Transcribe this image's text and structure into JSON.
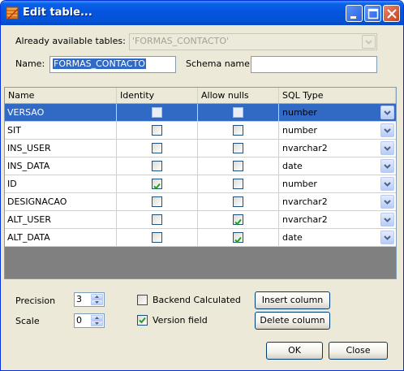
{
  "window": {
    "title": "Edit table..."
  },
  "form": {
    "available_label": "Already available tables:",
    "available_value": "'FORMAS_CONTACTO'",
    "name_label": "Name:",
    "name_value": "FORMAS_CONTACTO",
    "schema_label": "Schema name:",
    "schema_value": ""
  },
  "grid": {
    "headers": [
      "Name",
      "Identity",
      "Allow nulls",
      "SQL Type"
    ],
    "rows": [
      {
        "name": "VERSAO",
        "identity": false,
        "allow_nulls": false,
        "sql_type": "number",
        "selected": true
      },
      {
        "name": "SIT",
        "identity": false,
        "allow_nulls": false,
        "sql_type": "number",
        "selected": false
      },
      {
        "name": "INS_USER",
        "identity": false,
        "allow_nulls": false,
        "sql_type": "nvarchar2",
        "selected": false
      },
      {
        "name": "INS_DATA",
        "identity": false,
        "allow_nulls": false,
        "sql_type": "date",
        "selected": false
      },
      {
        "name": "ID",
        "identity": true,
        "allow_nulls": false,
        "sql_type": "number",
        "selected": false
      },
      {
        "name": "DESIGNACAO",
        "identity": false,
        "allow_nulls": false,
        "sql_type": "nvarchar2",
        "selected": false
      },
      {
        "name": "ALT_USER",
        "identity": false,
        "allow_nulls": true,
        "sql_type": "nvarchar2",
        "selected": false
      },
      {
        "name": "ALT_DATA",
        "identity": false,
        "allow_nulls": true,
        "sql_type": "date",
        "selected": false
      }
    ]
  },
  "props": {
    "precision_label": "Precision",
    "precision_value": "3",
    "scale_label": "Scale",
    "scale_value": "0",
    "backend_calculated_label": "Backend Calculated",
    "backend_calculated_checked": false,
    "version_field_label": "Version field",
    "version_field_checked": true,
    "insert_column_label": "Insert column",
    "delete_column_label": "Delete column"
  },
  "buttons": {
    "ok_label": "OK",
    "close_label": "Close"
  },
  "colors": {
    "titlebar": "#0454d8",
    "selection": "#316ac5",
    "check_green": "#21a121",
    "grid_empty": "#808080"
  },
  "icons": {
    "app": "table-edit-icon",
    "minimize": "minimize-icon",
    "maximize": "maximize-icon",
    "close": "close-icon",
    "dropdown": "chevron-down-icon",
    "spin_up": "spin-up-arrow-icon",
    "spin_down": "spin-down-arrow-icon",
    "check": "checkmark-icon"
  }
}
